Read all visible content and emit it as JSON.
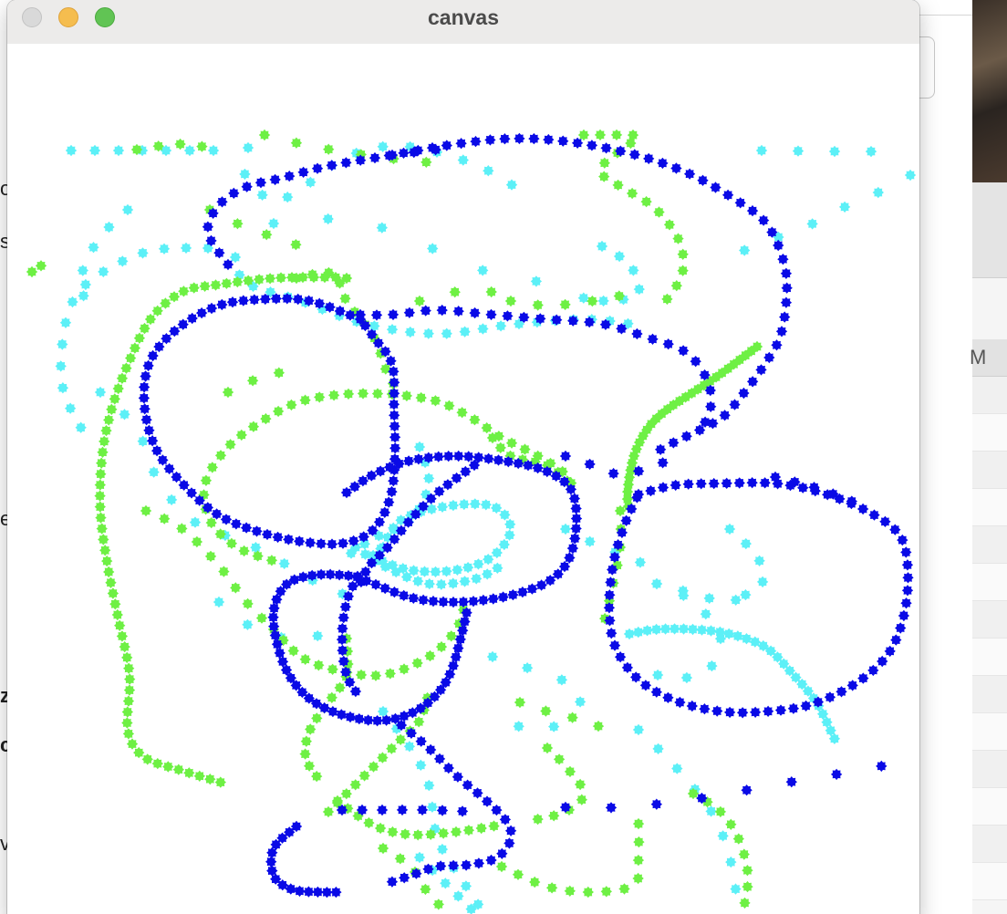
{
  "window": {
    "title": "canvas"
  },
  "background": {
    "doc_fragments": [
      "o",
      "s,",
      "e",
      "z",
      "c",
      "v"
    ],
    "column_header": "M",
    "grid_icon": "list-grid-icon"
  },
  "colors": {
    "blue": "#0a0ae6",
    "cyan": "#5cf0f7",
    "green": "#6ef044",
    "close_button": "#d9d9d9",
    "minimize_button": "#f5bd4f",
    "zoom_button": "#61c454"
  },
  "drawing": {
    "description_free": true,
    "series": [
      {
        "color_key": "blue",
        "dot": "star"
      },
      {
        "color_key": "cyan",
        "dot": "star"
      },
      {
        "color_key": "green",
        "dot": "star"
      }
    ]
  }
}
